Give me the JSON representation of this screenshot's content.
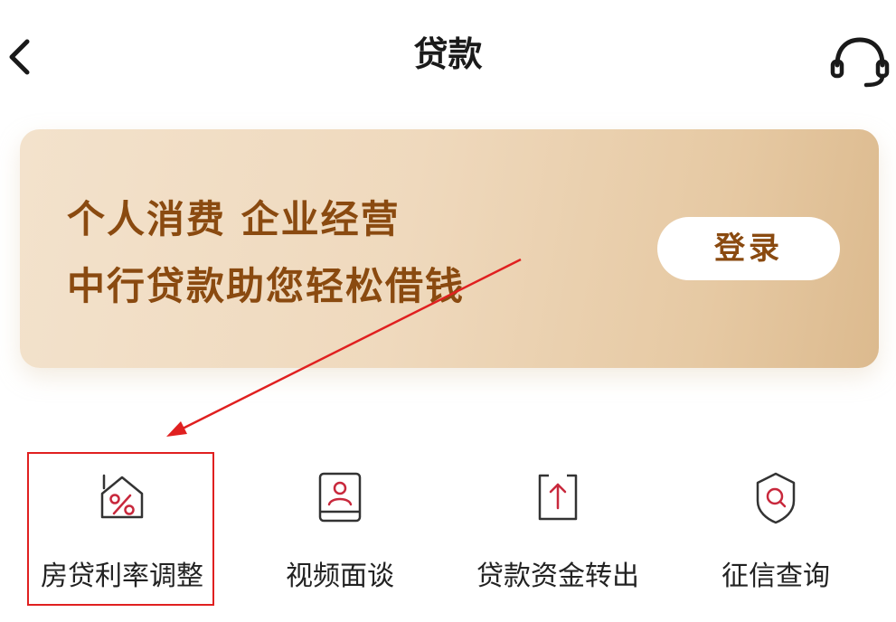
{
  "header": {
    "title": "贷款",
    "back_icon": "chevron-left-icon",
    "service_icon": "headset-icon"
  },
  "banner": {
    "line1": "个人消费 企业经营",
    "line2": "中行贷款助您轻松借钱",
    "login_label": "登录"
  },
  "menu": {
    "items": [
      {
        "label": "房贷利率调整",
        "icon": "house-percent-icon"
      },
      {
        "label": "视频面谈",
        "icon": "video-contact-icon"
      },
      {
        "label": "贷款资金转出",
        "icon": "transfer-out-icon"
      },
      {
        "label": "征信查询",
        "icon": "shield-search-icon"
      }
    ]
  },
  "colors": {
    "accent_text": "#8a4a10",
    "icon_red": "#c8283c",
    "annotation_red": "#e02020",
    "banner_light": "#f3e2cc",
    "banner_dark": "#dcba8e"
  }
}
